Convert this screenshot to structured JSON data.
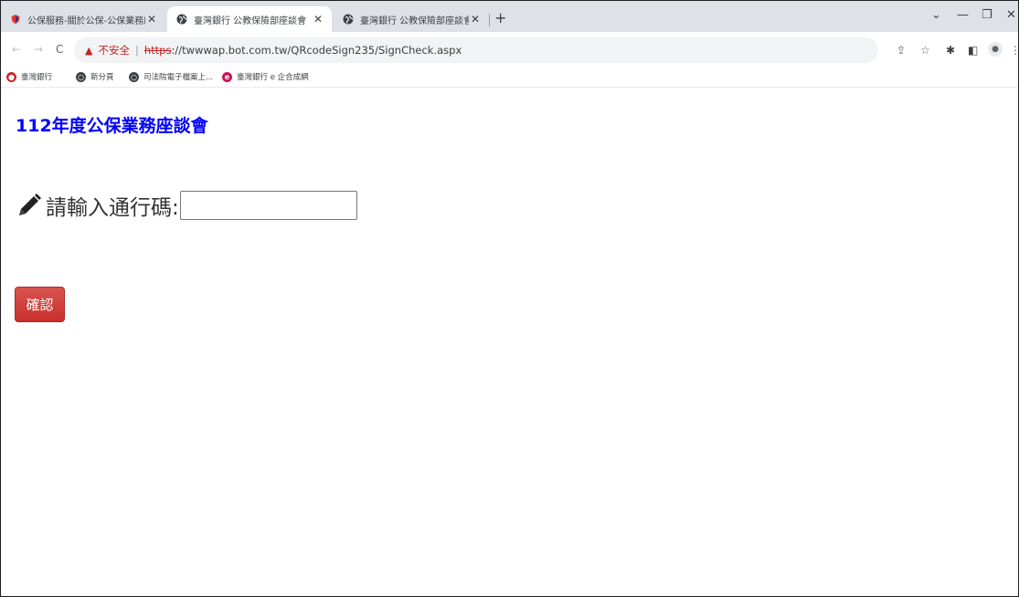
{
  "browser": {
    "tabs": [
      {
        "title": "公保服務-關於公保-公保業務座談",
        "active": false,
        "favicon": "shield-icon"
      },
      {
        "title": "臺灣銀行 公教保險部座談會",
        "active": true,
        "favicon": "globe-icon"
      },
      {
        "title": "臺灣銀行 公教保險部座談會",
        "active": false,
        "favicon": "globe-icon"
      }
    ],
    "address": {
      "warning_label": "不安全",
      "scheme": "https",
      "rest": "://twwwap.bot.com.tw/QRcodeSign235/SignCheck.aspx"
    },
    "bookmarks": [
      {
        "label": "臺灣銀行",
        "icon": "bank-icon",
        "color": "#c62828"
      },
      {
        "label": "新分頁",
        "icon": "globe-icon",
        "color": "#3c4043"
      },
      {
        "label": "司法院電子檔案上...",
        "icon": "globe-icon",
        "color": "#3c4043"
      },
      {
        "label": "臺灣銀行 e 企合成網",
        "icon": "e-icon",
        "color": "#c2185b"
      }
    ]
  },
  "page": {
    "title": "112年度公保業務座談會",
    "passcode_label": "請輸入通行碼:",
    "passcode_value": "",
    "confirm_label": "確認"
  },
  "colors": {
    "title": "#0000ff",
    "button": "#d9534f",
    "insecure": "#c5221f"
  }
}
